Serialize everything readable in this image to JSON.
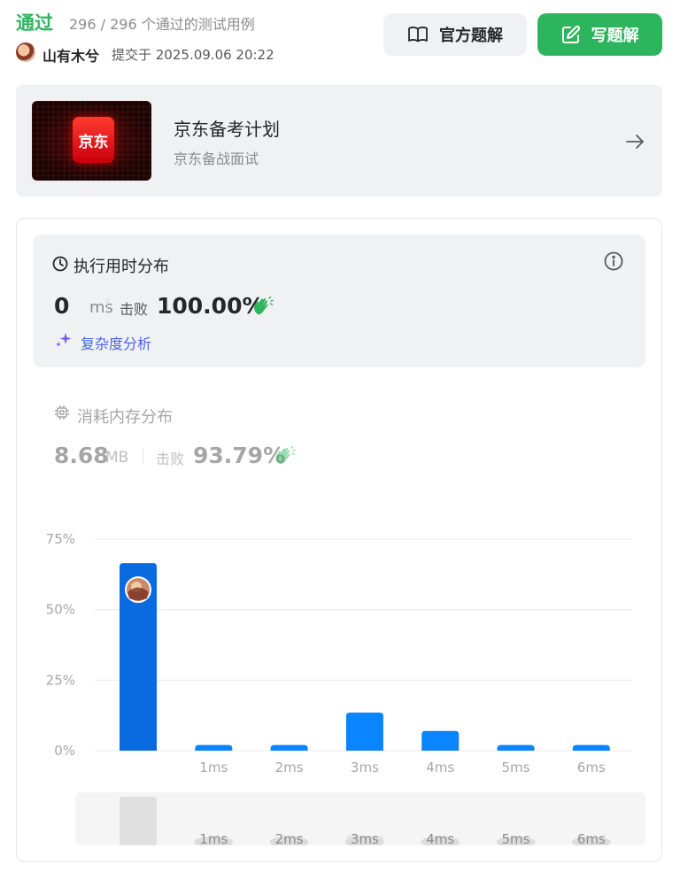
{
  "header": {
    "status": "通过",
    "test_count": "296 / 296 个通过的测试用例",
    "username": "山有木兮",
    "submit_time": "提交于 2025.09.06 20:22",
    "official_solution_label": "官方题解",
    "write_solution_label": "写题解"
  },
  "promo": {
    "logo_text": "京东",
    "title": "京东备考计划",
    "subtitle": "京东备战面试"
  },
  "runtime": {
    "title": "执行用时分布",
    "value": "0",
    "unit": "ms",
    "beat_label": "击败",
    "beat_value": "100.00%",
    "complexity_link": "复杂度分析"
  },
  "memory": {
    "title": "消耗内存分布",
    "value": "8.68",
    "unit": "MB",
    "beat_label": "击败",
    "beat_value": "93.79%"
  },
  "colors": {
    "accent_green": "#2db55d",
    "bar_blue": "#0a84ff",
    "bar_selected": "#0a6be0",
    "link_blue": "#4a64e8"
  },
  "chart_data": {
    "type": "bar",
    "categories": [
      "",
      "1ms",
      "2ms",
      "3ms",
      "4ms",
      "5ms",
      "6ms"
    ],
    "values": [
      66.5,
      2,
      2,
      13.5,
      7,
      2,
      2
    ],
    "y_ticks": [
      "75%",
      "50%",
      "25%",
      "0%"
    ],
    "ylim": [
      0,
      75
    ],
    "grid": true,
    "highlighted_category": "",
    "brush_labels": [
      "1ms",
      "2ms",
      "3ms",
      "4ms",
      "5ms",
      "6ms"
    ]
  }
}
